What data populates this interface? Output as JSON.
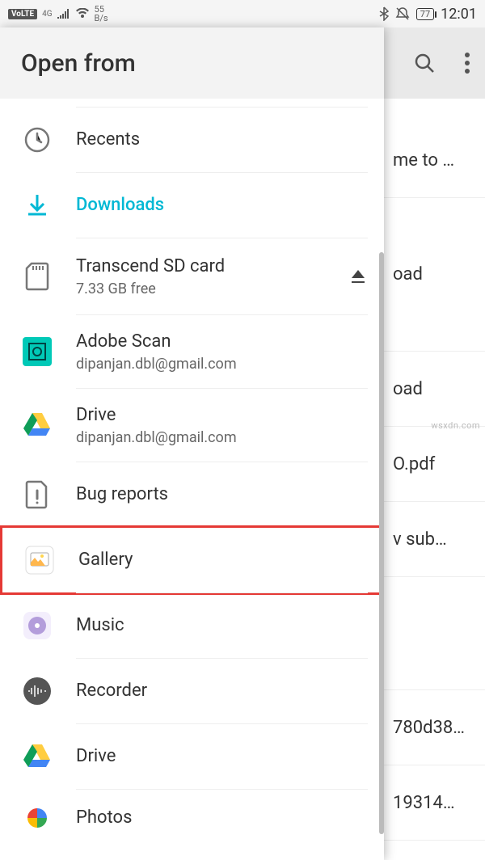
{
  "status": {
    "volte": "VoLTE",
    "net_type": "4G",
    "speed_num": "55",
    "speed_unit": "B/s",
    "battery": "77",
    "time": "12:01"
  },
  "backdrop": {
    "items": [
      {
        "label": "me to …"
      },
      {
        "label": "oad"
      },
      {
        "label": "oad"
      },
      {
        "label": "O.pdf"
      },
      {
        "label": "v sub…"
      },
      {
        "label": ""
      },
      {
        "label": "780d38…"
      },
      {
        "label": "19314…"
      }
    ]
  },
  "drawer": {
    "title": "Open from",
    "items": [
      {
        "id": "recents",
        "title": "Recents",
        "subtitle": ""
      },
      {
        "id": "downloads",
        "title": "Downloads",
        "subtitle": "",
        "active": true
      },
      {
        "id": "sdcard",
        "title": "Transcend SD card",
        "subtitle": "7.33 GB free",
        "eject": true
      },
      {
        "id": "adobescan",
        "title": "Adobe Scan",
        "subtitle": "dipanjan.dbl@gmail.com"
      },
      {
        "id": "drive1",
        "title": "Drive",
        "subtitle": "dipanjan.dbl@gmail.com"
      },
      {
        "id": "bugreports",
        "title": "Bug reports",
        "subtitle": ""
      },
      {
        "id": "gallery",
        "title": "Gallery",
        "subtitle": "",
        "highlight": true
      },
      {
        "id": "music",
        "title": "Music",
        "subtitle": ""
      },
      {
        "id": "recorder",
        "title": "Recorder",
        "subtitle": ""
      },
      {
        "id": "drive2",
        "title": "Drive",
        "subtitle": ""
      },
      {
        "id": "photos",
        "title": "Photos",
        "subtitle": ""
      }
    ]
  },
  "watermark": "wsxdn.com"
}
